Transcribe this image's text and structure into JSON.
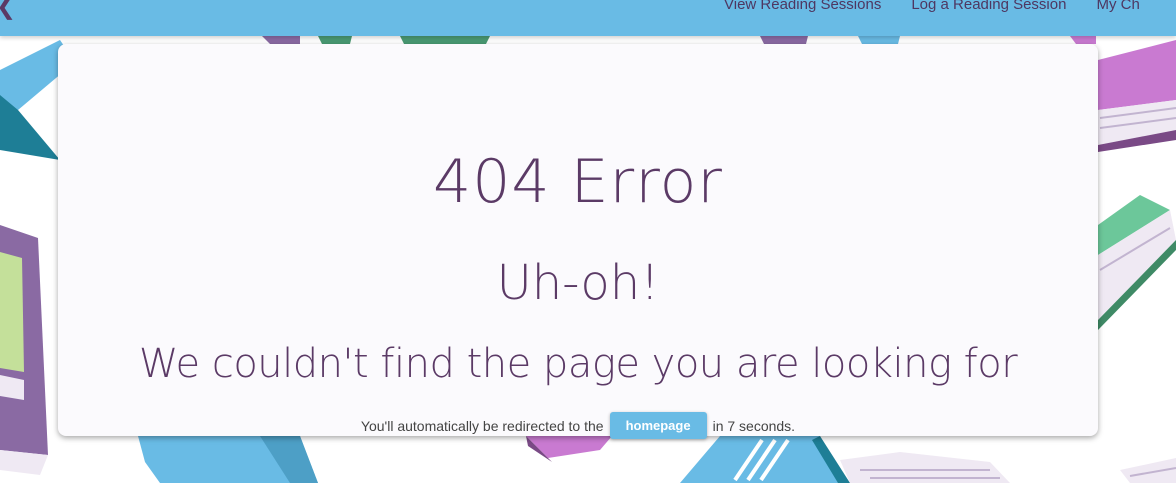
{
  "header": {
    "back_icon": "chevron-left-icon",
    "nav": [
      {
        "label": "View Reading Sessions"
      },
      {
        "label": "Log a Reading Session"
      },
      {
        "label": "My Ch"
      }
    ]
  },
  "error": {
    "code_title": "404 Error",
    "exclaim": "Uh-oh!",
    "message": "We couldn't find the page you are looking for",
    "redirect_prefix": "You'll automatically be redirected to the",
    "homepage_button": "homepage",
    "redirect_suffix": "in 7 seconds."
  },
  "colors": {
    "topbar": "#69bbe5",
    "text_purple": "#5b3a66",
    "button": "#69bbe5",
    "card": "#fbfafd"
  }
}
